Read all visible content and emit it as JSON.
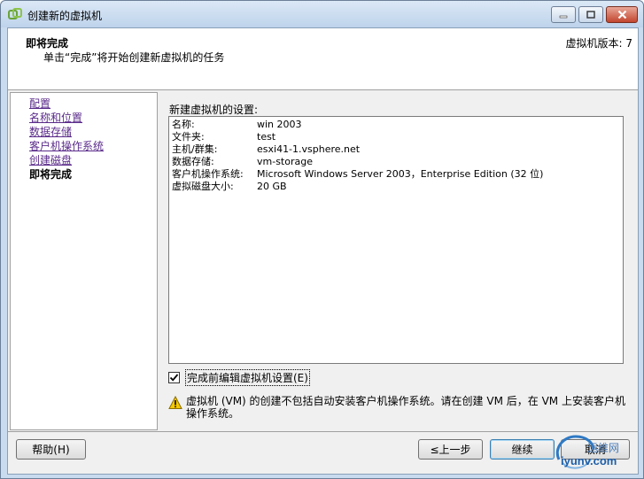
{
  "window": {
    "title": "创建新的虚拟机"
  },
  "header": {
    "title": "即将完成",
    "subtitle": "单击“完成”将开始创建新虚拟机的任务",
    "version": "虚拟机版本: 7"
  },
  "nav": {
    "items": [
      {
        "label": "配置",
        "current": false
      },
      {
        "label": "名称和位置",
        "current": false
      },
      {
        "label": "数据存储",
        "current": false
      },
      {
        "label": "客户机操作系统",
        "current": false
      },
      {
        "label": "创建磁盘",
        "current": false
      },
      {
        "label": "即将完成",
        "current": true
      }
    ]
  },
  "settings": {
    "label": "新建虚拟机的设置:",
    "rows": [
      {
        "key": "名称:",
        "value": "win 2003"
      },
      {
        "key": "文件夹:",
        "value": "test"
      },
      {
        "key": "主机/群集:",
        "value": "esxi41-1.vsphere.net"
      },
      {
        "key": "数据存储:",
        "value": "vm-storage"
      },
      {
        "key": "客户机操作系统:",
        "value": "Microsoft Windows Server 2003，Enterprise Edition (32 位)"
      },
      {
        "key": "虚拟磁盘大小:",
        "value": "20 GB"
      }
    ]
  },
  "edit_checkbox": {
    "label": "完成前编辑虚拟机设置(E)",
    "checked": true
  },
  "warning": {
    "icon": "warning-icon",
    "text": "虚拟机 (VM) 的创建不包括自动安装客户机操作系统。请在创建 VM 后，在 VM 上安装客户机操作系统。"
  },
  "buttons": {
    "help": "帮助(H)",
    "back": "≤上一步",
    "next": "继续",
    "cancel": "取消"
  },
  "watermark": {
    "text": "iyunv.com",
    "cn": "运维网"
  }
}
